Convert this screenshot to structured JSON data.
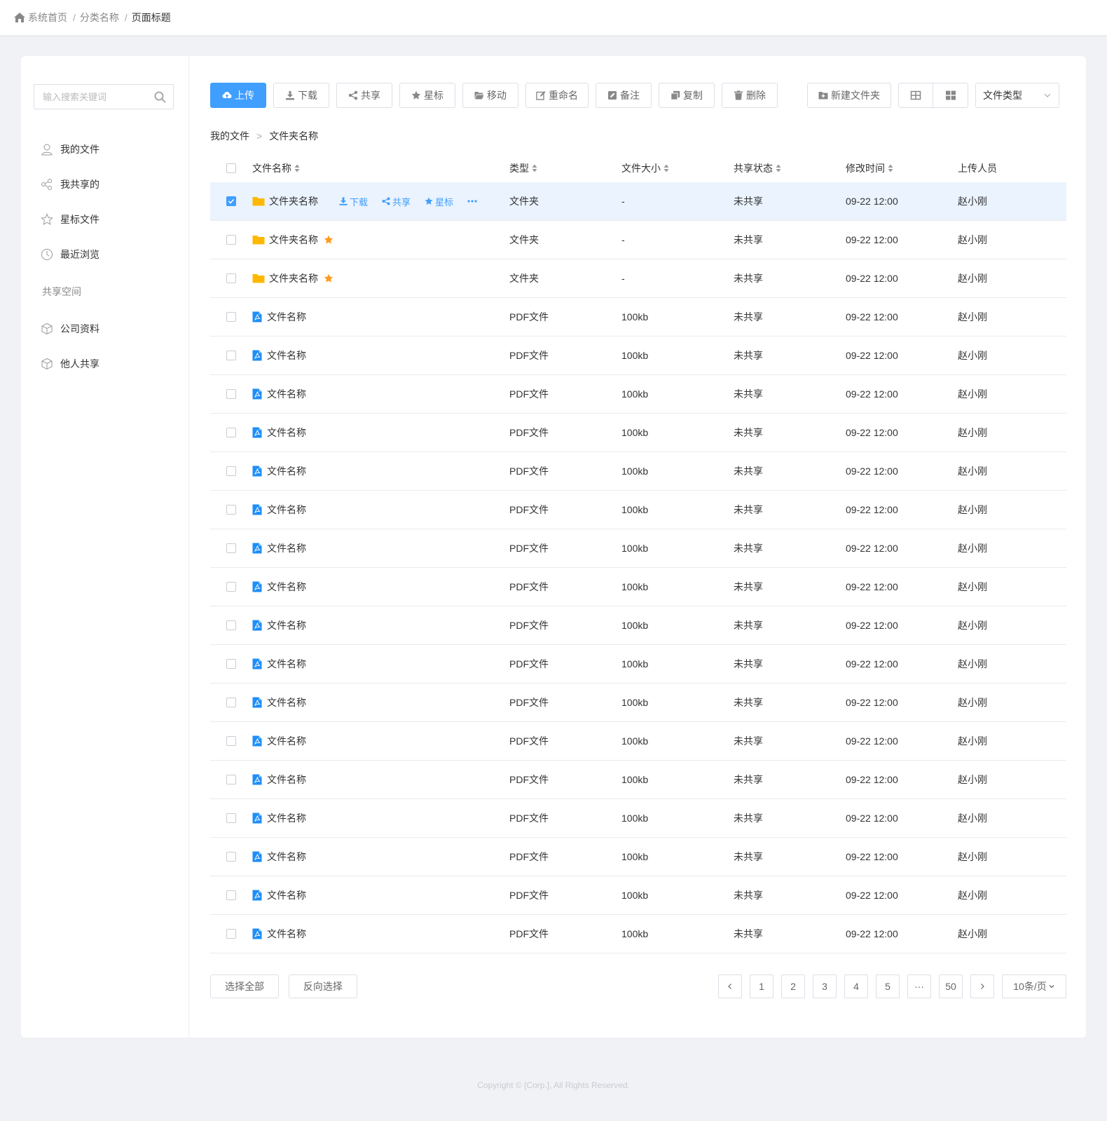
{
  "breadcrumb": {
    "home": "系统首页",
    "category": "分类名称",
    "current": "页面标题",
    "separator": "/"
  },
  "sidebar": {
    "search_placeholder": "输入搜索关键词",
    "items": [
      {
        "label": "我的文件",
        "icon": "user-icon"
      },
      {
        "label": "我共享的",
        "icon": "share-icon"
      },
      {
        "label": "星标文件",
        "icon": "star-icon"
      },
      {
        "label": "最近浏览",
        "icon": "clock-icon"
      }
    ],
    "section_title": "共享空间",
    "shared_items": [
      {
        "label": "公司资料",
        "icon": "cube-icon"
      },
      {
        "label": "他人共享",
        "icon": "cube-icon"
      }
    ]
  },
  "toolbar": {
    "upload": "上传",
    "download": "下载",
    "share": "共享",
    "star": "星标",
    "move": "移动",
    "rename": "重命名",
    "note": "备注",
    "copy": "复制",
    "delete": "删除",
    "new_folder": "新建文件夹",
    "file_type": "文件类型"
  },
  "path": {
    "root": "我的文件",
    "separator": ">",
    "current": "文件夹名称"
  },
  "table": {
    "headers": {
      "name": "文件名称",
      "type": "类型",
      "size": "文件大小",
      "share": "共享状态",
      "time": "修改时间",
      "user": "上传人员"
    },
    "row_actions": {
      "download": "下载",
      "share": "共享",
      "star": "星标"
    },
    "rows": [
      {
        "name": "文件夹名称",
        "type": "文件夹",
        "size": "-",
        "share": "未共享",
        "time": "09-22 12:00",
        "user": "赵小刚"
      },
      {
        "name": "文件夹名称",
        "type": "文件夹",
        "size": "-",
        "share": "未共享",
        "time": "09-22 12:00",
        "user": "赵小刚"
      },
      {
        "name": "文件夹名称",
        "type": "文件夹",
        "size": "-",
        "share": "未共享",
        "time": "09-22 12:00",
        "user": "赵小刚"
      },
      {
        "name": "文件名称",
        "type": "PDF文件",
        "size": "100kb",
        "share": "未共享",
        "time": "09-22 12:00",
        "user": "赵小刚"
      },
      {
        "name": "文件名称",
        "type": "PDF文件",
        "size": "100kb",
        "share": "未共享",
        "time": "09-22 12:00",
        "user": "赵小刚"
      },
      {
        "name": "文件名称",
        "type": "PDF文件",
        "size": "100kb",
        "share": "未共享",
        "time": "09-22 12:00",
        "user": "赵小刚"
      },
      {
        "name": "文件名称",
        "type": "PDF文件",
        "size": "100kb",
        "share": "未共享",
        "time": "09-22 12:00",
        "user": "赵小刚"
      },
      {
        "name": "文件名称",
        "type": "PDF文件",
        "size": "100kb",
        "share": "未共享",
        "time": "09-22 12:00",
        "user": "赵小刚"
      },
      {
        "name": "文件名称",
        "type": "PDF文件",
        "size": "100kb",
        "share": "未共享",
        "time": "09-22 12:00",
        "user": "赵小刚"
      },
      {
        "name": "文件名称",
        "type": "PDF文件",
        "size": "100kb",
        "share": "未共享",
        "time": "09-22 12:00",
        "user": "赵小刚"
      },
      {
        "name": "文件名称",
        "type": "PDF文件",
        "size": "100kb",
        "share": "未共享",
        "time": "09-22 12:00",
        "user": "赵小刚"
      },
      {
        "name": "文件名称",
        "type": "PDF文件",
        "size": "100kb",
        "share": "未共享",
        "time": "09-22 12:00",
        "user": "赵小刚"
      },
      {
        "name": "文件名称",
        "type": "PDF文件",
        "size": "100kb",
        "share": "未共享",
        "time": "09-22 12:00",
        "user": "赵小刚"
      },
      {
        "name": "文件名称",
        "type": "PDF文件",
        "size": "100kb",
        "share": "未共享",
        "time": "09-22 12:00",
        "user": "赵小刚"
      },
      {
        "name": "文件名称",
        "type": "PDF文件",
        "size": "100kb",
        "share": "未共享",
        "time": "09-22 12:00",
        "user": "赵小刚"
      },
      {
        "name": "文件名称",
        "type": "PDF文件",
        "size": "100kb",
        "share": "未共享",
        "time": "09-22 12:00",
        "user": "赵小刚"
      },
      {
        "name": "文件名称",
        "type": "PDF文件",
        "size": "100kb",
        "share": "未共享",
        "time": "09-22 12:00",
        "user": "赵小刚"
      },
      {
        "name": "文件名称",
        "type": "PDF文件",
        "size": "100kb",
        "share": "未共享",
        "time": "09-22 12:00",
        "user": "赵小刚"
      },
      {
        "name": "文件名称",
        "type": "PDF文件",
        "size": "100kb",
        "share": "未共享",
        "time": "09-22 12:00",
        "user": "赵小刚"
      },
      {
        "name": "文件名称",
        "type": "PDF文件",
        "size": "100kb",
        "share": "未共享",
        "time": "09-22 12:00",
        "user": "赵小刚"
      }
    ]
  },
  "footer": {
    "select_all": "选择全部",
    "invert_select": "反向选择"
  },
  "pagination": {
    "pages": [
      "1",
      "2",
      "3",
      "4",
      "5"
    ],
    "ellipsis": "···",
    "last": "50",
    "page_size": "10条/页"
  },
  "copyright": "Copyright © [Corp.], All Rights Reserved.",
  "colors": {
    "primary": "#409eff",
    "folder": "#ffb800",
    "star": "#ff9a1e",
    "pdf": "#1e8ef8",
    "selected_row": "#eaf3fe"
  }
}
